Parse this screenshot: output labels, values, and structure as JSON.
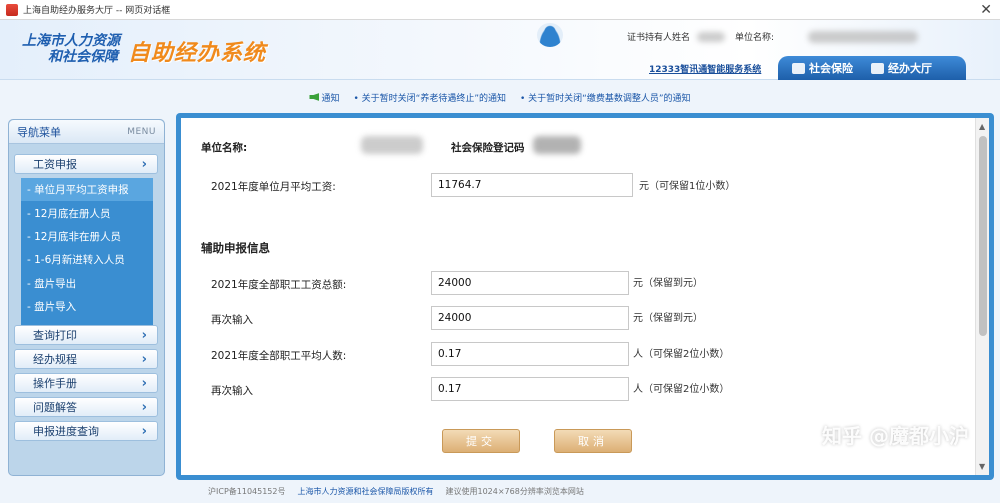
{
  "window": {
    "title": "上海自助经办服务大厅 -- 网页对话框"
  },
  "header": {
    "org_line1": "上海市人力资源",
    "org_line2": "和社会保障",
    "system_name": "自助经办系统",
    "holder_label": "证书持有人姓名",
    "unit_label": "单位名称:",
    "hotline": "12333智讯通智能服务系统",
    "tabs": [
      {
        "label": "社会保险",
        "icon": "id-card-icon"
      },
      {
        "label": "经办大厅",
        "icon": "building-icon"
      }
    ]
  },
  "notices": [
    "通知",
    "• 关于暂时关闭“养老待遇终止”的通知",
    "• 关于暂时关闭“缴费基数调整人员”的通知"
  ],
  "sidebar": {
    "title": "导航菜单",
    "menu_tag": "MENU",
    "sections": [
      {
        "label": "工资申报"
      },
      {
        "label": "查询打印"
      },
      {
        "label": "经办规程"
      },
      {
        "label": "操作手册"
      },
      {
        "label": "问题解答"
      },
      {
        "label": "申报进度查询"
      }
    ],
    "sub_items": [
      {
        "label": "- 单位月平均工资申报",
        "active": true
      },
      {
        "label": "- 12月底在册人员"
      },
      {
        "label": "- 12月底非在册人员"
      },
      {
        "label": "- 1-6月新进转入人员"
      },
      {
        "label": "- 盘片导出"
      },
      {
        "label": "- 盘片导入"
      }
    ]
  },
  "form": {
    "unit_name_label": "单位名称:",
    "ss_reg_label": "社会保险登记码",
    "avg_wage_label": "2021年度单位月平均工资:",
    "avg_wage_value": "11764.7",
    "avg_wage_hint": "元（可保留1位小数）",
    "aux_title": "辅助申报信息",
    "total_wage_label": "2021年度全部职工工资总额:",
    "total_wage_value": "24000",
    "total_wage_hint": "元（保留到元）",
    "reenter_label": "再次输入",
    "total_wage_re_value": "24000",
    "total_wage_re_hint": "元（保留到元）",
    "avg_staff_label": "2021年度全部职工平均人数:",
    "avg_staff_value": "0.17",
    "avg_staff_hint": "人（可保留2位小数）",
    "avg_staff_re_value": "0.17",
    "avg_staff_re_hint": "人（可保留2位小数）",
    "submit_label": "提交",
    "cancel_label": "取消"
  },
  "watermark": "知乎 @魔都小沪",
  "footer": {
    "icp": "沪ICP备11045152号",
    "org_link": "上海市人力资源和社会保障局版权所有",
    "note": "建议使用1024×768分辨率浏览本网站"
  }
}
